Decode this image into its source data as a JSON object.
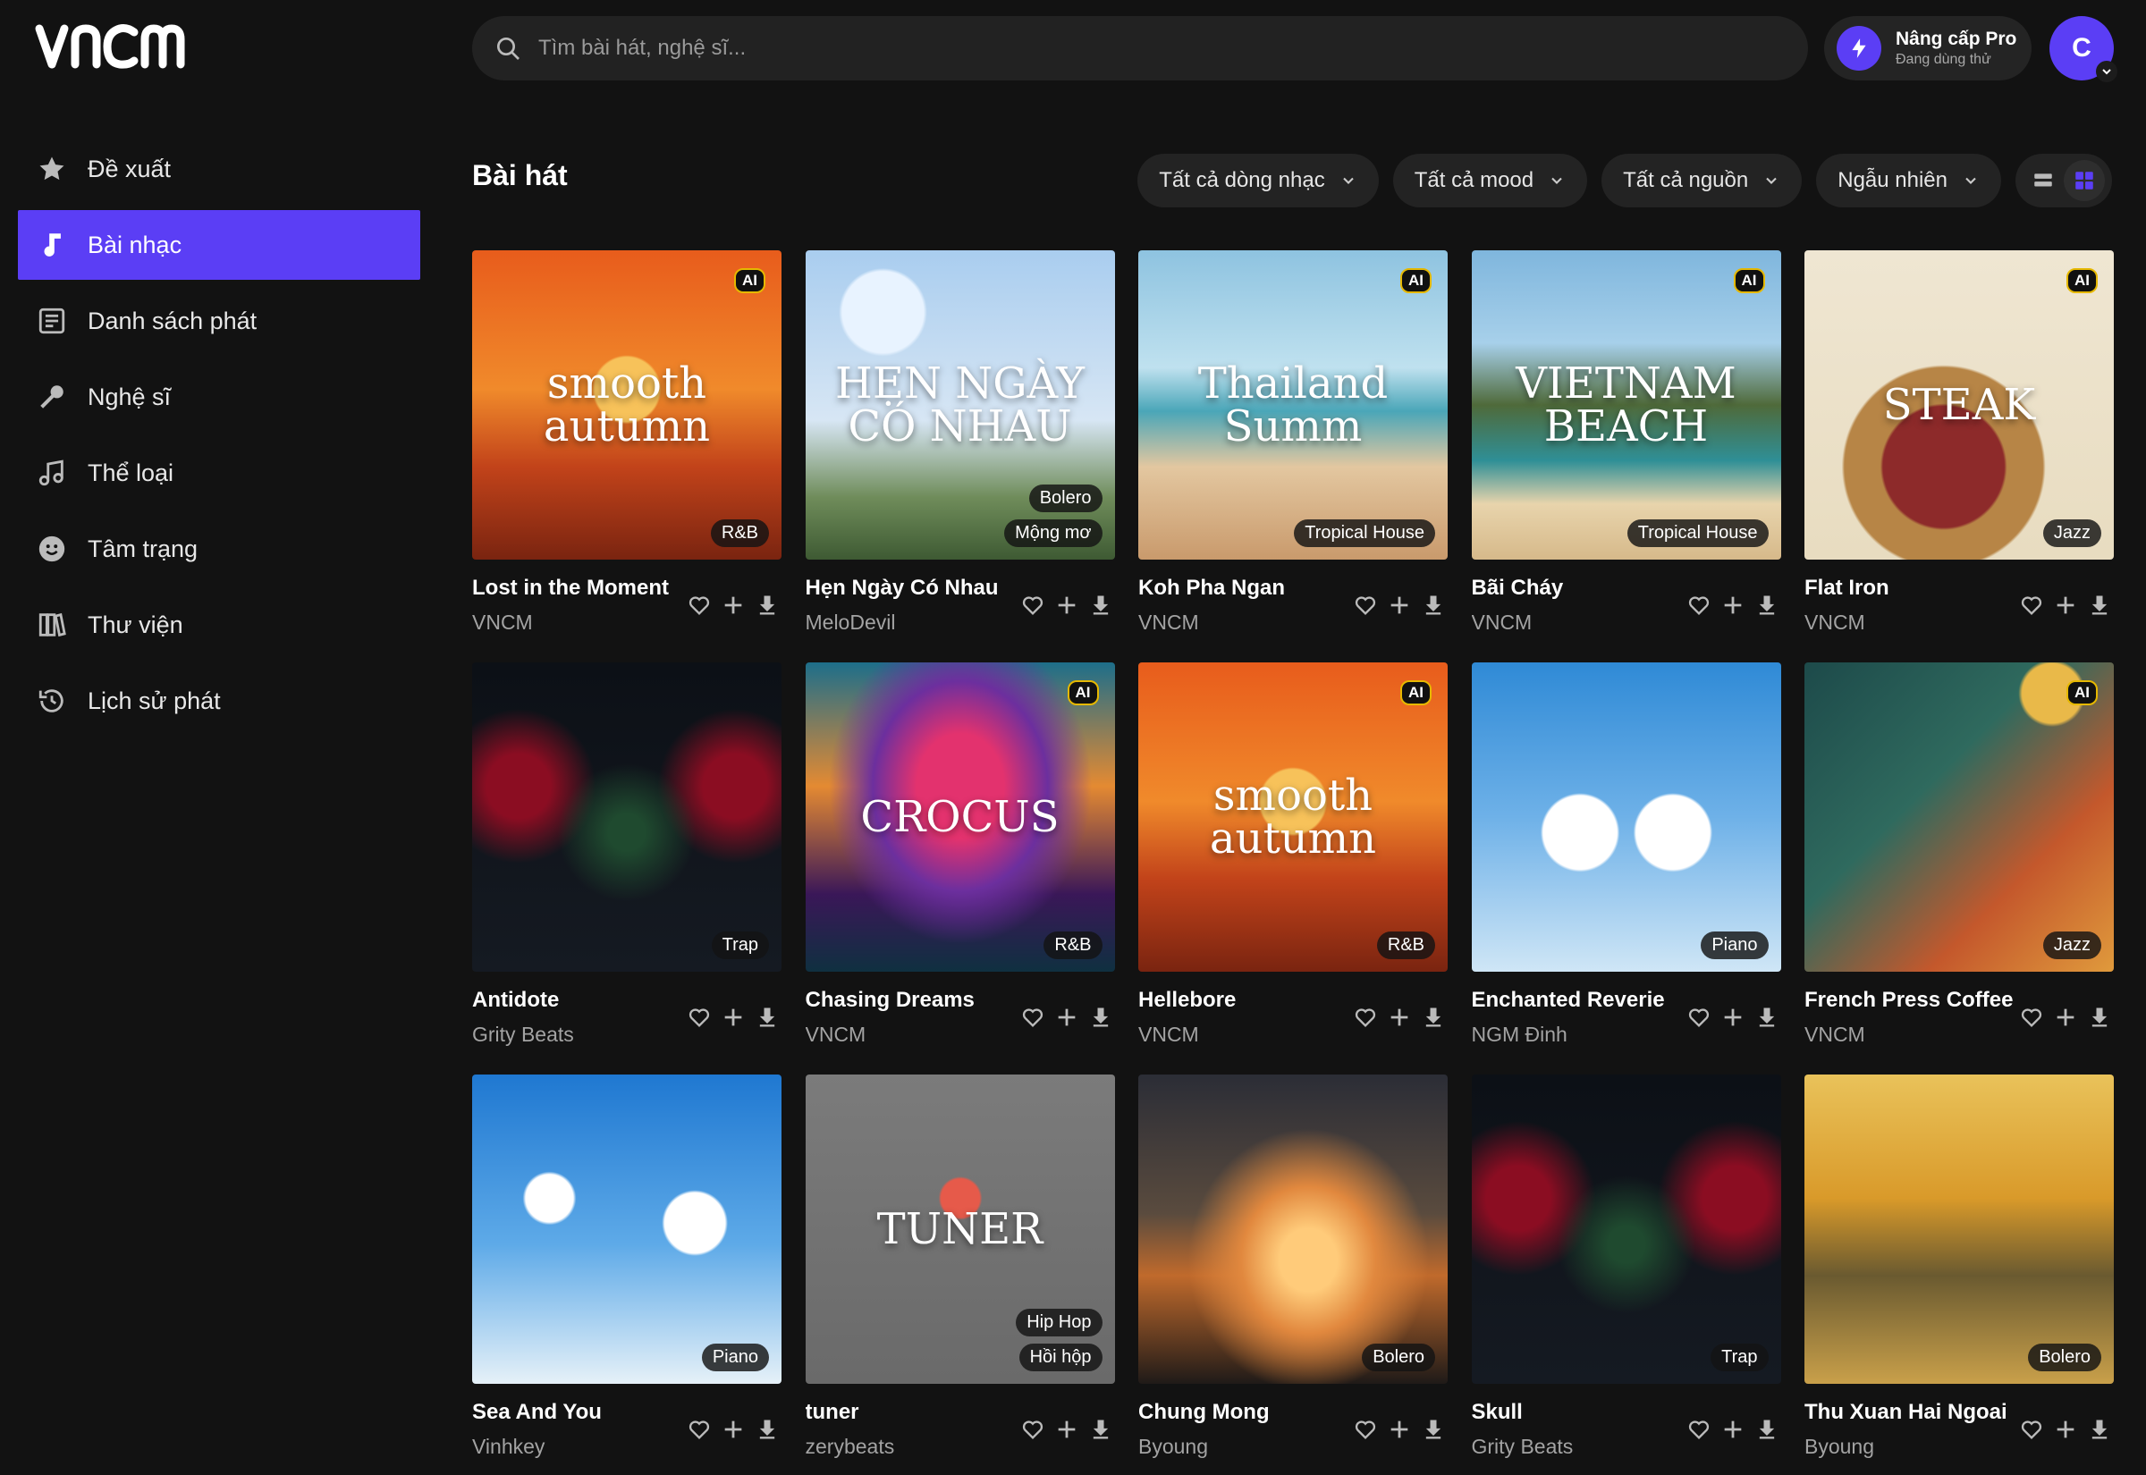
{
  "brand": {
    "logo_text": "VNCM",
    "accent": "#5b3ef5"
  },
  "sidebar": {
    "items": [
      {
        "label": "Đề xuất",
        "icon": "star-icon",
        "active": false
      },
      {
        "label": "Bài nhạc",
        "icon": "music-note-icon",
        "active": true
      },
      {
        "label": "Danh sách phát",
        "icon": "playlist-icon",
        "active": false
      },
      {
        "label": "Nghệ sĩ",
        "icon": "microphone-icon",
        "active": false
      },
      {
        "label": "Thể loại",
        "icon": "music-notes-icon",
        "active": false
      },
      {
        "label": "Tâm trạng",
        "icon": "smiley-icon",
        "active": false
      },
      {
        "label": "Thư viện",
        "icon": "library-icon",
        "active": false
      },
      {
        "label": "Lịch sử phát",
        "icon": "history-icon",
        "active": false
      }
    ]
  },
  "search": {
    "placeholder": "Tìm bài hát, nghệ sĩ..."
  },
  "pro": {
    "title": "Nâng cấp Pro",
    "subtitle": "Đang dùng thử"
  },
  "user": {
    "initial": "C"
  },
  "header": {
    "title": "Bài hát",
    "filters": [
      "Tất cả dòng nhạc",
      "Tất cả mood",
      "Tất cả nguồn",
      "Ngẫu nhiên"
    ]
  },
  "songs": [
    {
      "title": "Lost in the Moment",
      "artist": "VNCM",
      "cover_text": "smooth autumn",
      "ai": "AI",
      "tags": [
        "R&B"
      ],
      "palette": "autumn"
    },
    {
      "title": "Hẹn Ngày Có Nhau",
      "artist": "MeloDevil",
      "cover_text": "HẸN NGÀY CÓ NHAU",
      "ai": "",
      "tags": [
        "Bolero",
        "Mộng mơ"
      ],
      "palette": "flowers"
    },
    {
      "title": "Koh Pha Ngan",
      "artist": "VNCM",
      "cover_text": "Thailand Summ",
      "ai": "AI",
      "tags": [
        "Tropical House"
      ],
      "palette": "beach"
    },
    {
      "title": "Bãi Cháy",
      "artist": "VNCM",
      "cover_text": "VIETNAM BEACH",
      "ai": "AI",
      "tags": [
        "Tropical House"
      ],
      "palette": "cliff"
    },
    {
      "title": "Flat Iron",
      "artist": "VNCM",
      "cover_text": "STEAK",
      "ai": "AI",
      "tags": [
        "Jazz"
      ],
      "palette": "steak"
    },
    {
      "title": "Antidote",
      "artist": "Grity Beats",
      "cover_text": "",
      "ai": "",
      "tags": [
        "Trap"
      ],
      "palette": "dark"
    },
    {
      "title": "Chasing Dreams",
      "artist": "VNCM",
      "cover_text": "CROCUS",
      "ai": "AI",
      "tags": [
        "R&B"
      ],
      "palette": "crocus"
    },
    {
      "title": "Hellebore",
      "artist": "VNCM",
      "cover_text": "smooth autumn",
      "ai": "AI",
      "tags": [
        "R&B"
      ],
      "palette": "autumn"
    },
    {
      "title": "Enchanted Reverie",
      "artist": "NGM Đinh",
      "cover_text": "",
      "ai": "",
      "tags": [
        "Piano"
      ],
      "palette": "sky"
    },
    {
      "title": "French Press Coffee",
      "artist": "VNCM",
      "cover_text": "",
      "ai": "AI",
      "tags": [
        "Jazz"
      ],
      "palette": "jazz"
    },
    {
      "title": "Sea And You",
      "artist": "Vinhkey",
      "cover_text": "",
      "ai": "",
      "tags": [
        "Piano"
      ],
      "palette": "sky2"
    },
    {
      "title": "tuner",
      "artist": "zerybeats",
      "cover_text": "TUNER",
      "ai": "",
      "tags": [
        "Hip Hop",
        "Hồi hộp"
      ],
      "palette": "gray"
    },
    {
      "title": "Chung Mong",
      "artist": "Byoung",
      "cover_text": "",
      "ai": "",
      "tags": [
        "Bolero"
      ],
      "palette": "sunset"
    },
    {
      "title": "Skull",
      "artist": "Grity Beats",
      "cover_text": "",
      "ai": "",
      "tags": [
        "Trap"
      ],
      "palette": "dark"
    },
    {
      "title": "Thu Xuan Hai Ngoai",
      "artist": "Byoung",
      "cover_text": "",
      "ai": "",
      "tags": [
        "Bolero"
      ],
      "palette": "park"
    }
  ]
}
